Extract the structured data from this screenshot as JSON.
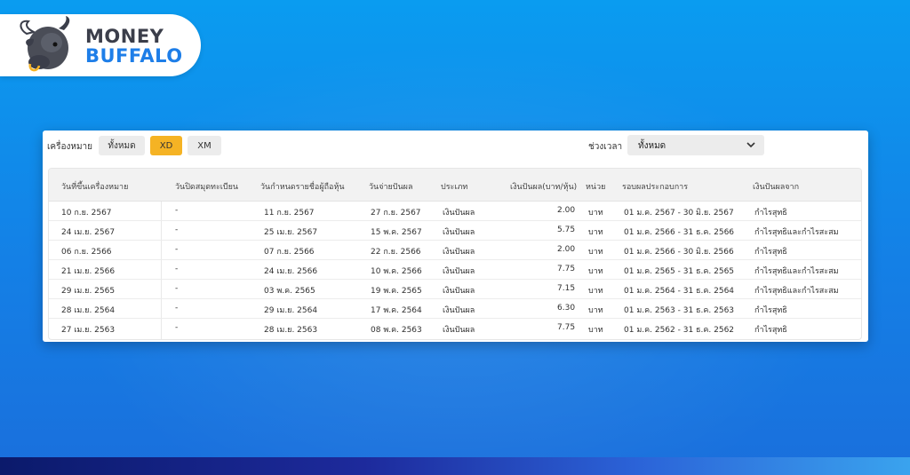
{
  "brand": {
    "line1": "MONEY",
    "line2": "BUFFALO"
  },
  "filters": {
    "type_label": "เครื่องหมาย",
    "chips": [
      {
        "label": "ทั้งหมด",
        "active": false
      },
      {
        "label": "XD",
        "active": true
      },
      {
        "label": "XM",
        "active": false
      }
    ],
    "period_label": "ช่วงเวลา",
    "period_value": "ทั้งหมด"
  },
  "table": {
    "headers": [
      "วันที่ขึ้นเครื่องหมาย",
      "วันปิดสมุดทะเบียน",
      "วันกำหนดรายชื่อผู้ถือหุ้น",
      "วันจ่ายปันผล",
      "ประเภท",
      "เงินปันผล(บาท/หุ้น)",
      "หน่วย",
      "รอบผลประกอบการ",
      "เงินปันผลจาก"
    ],
    "rows": [
      [
        "10 ก.ย. 2567",
        "-",
        "11 ก.ย. 2567",
        "27 ก.ย. 2567",
        "เงินปันผล",
        "2.00",
        "บาท",
        "01 ม.ค. 2567 - 30 มิ.ย. 2567",
        "กำไรสุทธิ"
      ],
      [
        "24 เม.ย. 2567",
        "-",
        "25 เม.ย. 2567",
        "15 พ.ค. 2567",
        "เงินปันผล",
        "5.75",
        "บาท",
        "01 ม.ค. 2566 - 31 ธ.ค. 2566",
        "กำไรสุทธิและกำไรสะสม"
      ],
      [
        "06 ก.ย. 2566",
        "-",
        "07 ก.ย. 2566",
        "22 ก.ย. 2566",
        "เงินปันผล",
        "2.00",
        "บาท",
        "01 ม.ค. 2566 - 30 มิ.ย. 2566",
        "กำไรสุทธิ"
      ],
      [
        "21 เม.ย. 2566",
        "-",
        "24 เม.ย. 2566",
        "10 พ.ค. 2566",
        "เงินปันผล",
        "7.75",
        "บาท",
        "01 ม.ค. 2565 - 31 ธ.ค. 2565",
        "กำไรสุทธิและกำไรสะสม"
      ],
      [
        "29 เม.ย. 2565",
        "-",
        "03 พ.ค. 2565",
        "19 พ.ค. 2565",
        "เงินปันผล",
        "7.15",
        "บาท",
        "01 ม.ค. 2564 - 31 ธ.ค. 2564",
        "กำไรสุทธิและกำไรสะสม"
      ],
      [
        "28 เม.ย. 2564",
        "-",
        "29 เม.ย. 2564",
        "17 พ.ค. 2564",
        "เงินปันผล",
        "6.30",
        "บาท",
        "01 ม.ค. 2563 - 31 ธ.ค. 2563",
        "กำไรสุทธิ"
      ],
      [
        "27 เม.ย. 2563",
        "-",
        "28 เม.ย. 2563",
        "08 พ.ค. 2563",
        "เงินปันผล",
        "7.75",
        "บาท",
        "01 ม.ค. 2562 - 31 ธ.ค. 2562",
        "กำไรสุทธิ"
      ]
    ]
  },
  "colors": {
    "accent": "#f5b324",
    "brand_blue": "#1e7ee8",
    "background": "#1480e6"
  },
  "icons": {
    "mascot": "buffalo-mascot-icon",
    "dropdown": "chevron-down-icon"
  }
}
